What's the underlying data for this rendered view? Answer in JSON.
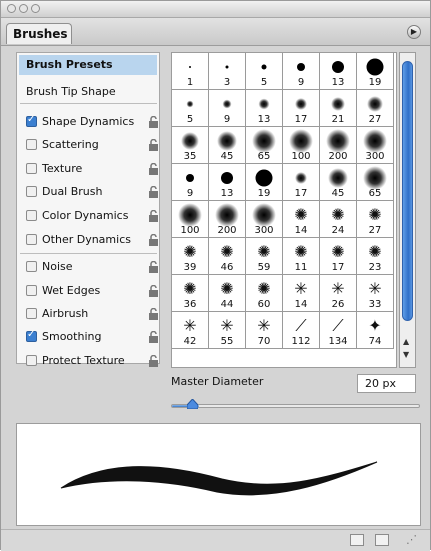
{
  "panel": {
    "tab_label": "Brushes",
    "menu_icon": "panel-menu-icon"
  },
  "sidebar": {
    "brush_presets_label": "Brush Presets",
    "brush_tip_shape_label": "Brush Tip Shape",
    "options": [
      {
        "label": "Shape Dynamics",
        "checked": true
      },
      {
        "label": "Scattering",
        "checked": false
      },
      {
        "label": "Texture",
        "checked": false
      },
      {
        "label": "Dual Brush",
        "checked": false
      },
      {
        "label": "Color Dynamics",
        "checked": false
      },
      {
        "label": "Other Dynamics",
        "checked": false
      },
      {
        "label": "Noise",
        "checked": false
      },
      {
        "label": "Wet Edges",
        "checked": false
      },
      {
        "label": "Airbrush",
        "checked": false
      },
      {
        "label": "Smoothing",
        "checked": true
      },
      {
        "label": "Protect Texture",
        "checked": false
      }
    ]
  },
  "brush_grid": {
    "rows": [
      [
        "1",
        "3",
        "5",
        "9",
        "13",
        "19"
      ],
      [
        "5",
        "9",
        "13",
        "17",
        "21",
        "27"
      ],
      [
        "35",
        "45",
        "65",
        "100",
        "200",
        "300"
      ],
      [
        "9",
        "13",
        "19",
        "17",
        "45",
        "65"
      ],
      [
        "100",
        "200",
        "300",
        "14",
        "24",
        "27"
      ],
      [
        "39",
        "46",
        "59",
        "11",
        "17",
        "23"
      ],
      [
        "36",
        "44",
        "60",
        "14",
        "26",
        "33"
      ],
      [
        "42",
        "55",
        "70",
        "112",
        "134",
        "74"
      ]
    ],
    "types": [
      [
        "hard",
        "hard",
        "hard",
        "hard",
        "hard",
        "hard"
      ],
      [
        "soft",
        "soft",
        "soft",
        "soft",
        "soft",
        "soft"
      ],
      [
        "soft",
        "soft",
        "soft",
        "soft",
        "soft",
        "soft"
      ],
      [
        "hard",
        "hard",
        "hard",
        "soft",
        "soft",
        "soft"
      ],
      [
        "soft",
        "soft",
        "soft",
        "spatter",
        "spatter",
        "spatter"
      ],
      [
        "spatter",
        "spatter",
        "spatter",
        "spatter",
        "spatter",
        "spatter"
      ],
      [
        "spatter",
        "spatter",
        "spatter",
        "star",
        "star",
        "star"
      ],
      [
        "star",
        "star",
        "star",
        "grass",
        "grass",
        "leaf"
      ]
    ],
    "highlighted_cell": "13",
    "highlight_color": "#d9252a"
  },
  "master_diameter": {
    "label": "Master Diameter",
    "value": "20 px",
    "slider_fraction": 0.11
  },
  "colors": {
    "selection_bg": "#b9d5ee",
    "accent_blue": "#3b7fd0"
  }
}
